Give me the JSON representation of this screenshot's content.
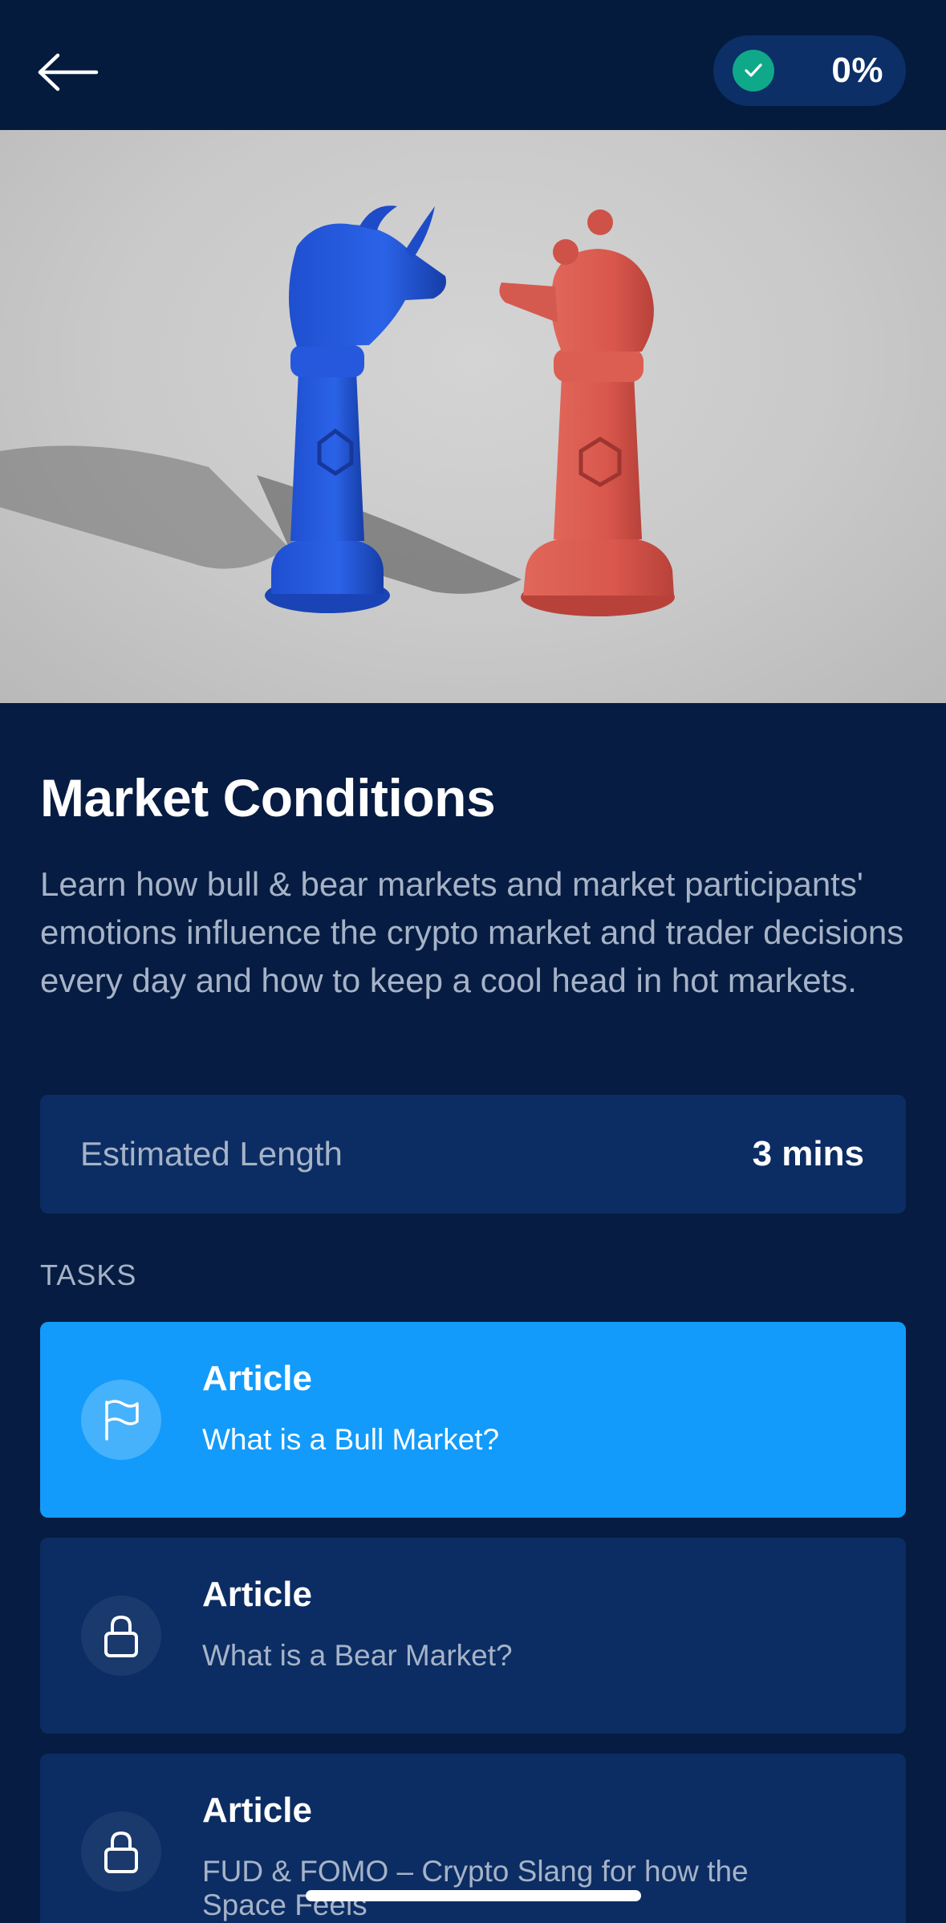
{
  "header": {
    "back_icon": "arrow-left-icon",
    "progress": {
      "icon": "check-circle-icon",
      "value_text": "0%",
      "accent_color": "#0fa98a"
    }
  },
  "hero": {
    "description_icon": "bull-and-bear-chess-pieces-illustration",
    "bull_color": "#2457d6",
    "bear_color": "#d9574c"
  },
  "lesson": {
    "title": "Market Conditions",
    "description": "Learn how bull & bear markets and market participants' emotions influence the crypto market and trader decisions every day and how to keep a cool head in hot markets."
  },
  "estimate": {
    "label": "Estimated Length",
    "value": "3 mins"
  },
  "tasks": {
    "heading": "TASKS",
    "items": [
      {
        "type": "Article",
        "title": "What is a Bull Market?",
        "icon": "flag-icon",
        "state": "active"
      },
      {
        "type": "Article",
        "title": "What is a Bear Market?",
        "icon": "lock-icon",
        "state": "locked"
      },
      {
        "type": "Article",
        "title": "FUD & FOMO – Crypto Slang for how the Space Feels",
        "icon": "lock-icon",
        "state": "locked"
      }
    ]
  },
  "colors": {
    "background": "#061c42",
    "card": "#0c2d63",
    "active_card": "#129bfb",
    "muted_text": "#a6b3c7"
  }
}
